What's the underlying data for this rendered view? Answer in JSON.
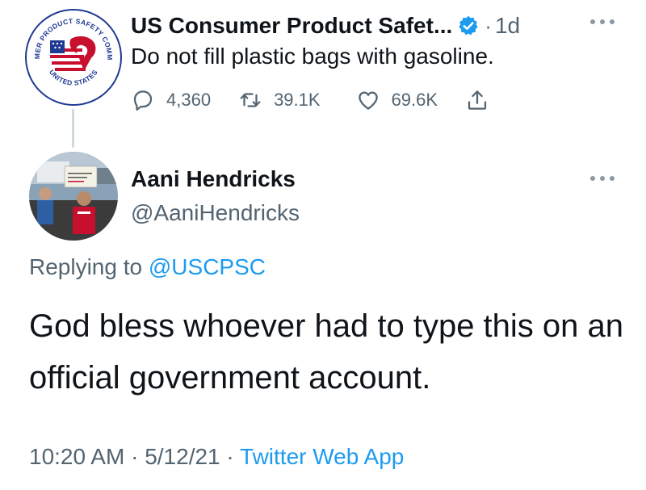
{
  "parent_tweet": {
    "display_name": "US Consumer Product Safet...",
    "time_ago": "1d",
    "separator": "·",
    "text": "Do not fill plastic bags with gasoline.",
    "seal": {
      "top_text": "CONSUMER PRODUCT SAFETY COMMISSION",
      "bottom_text": "UNITED STATES"
    },
    "actions": {
      "replies": "4,360",
      "retweets": "39.1K",
      "likes": "69.6K"
    },
    "icons": [
      "verified-badge-icon",
      "more-icon",
      "reply-icon",
      "retweet-icon",
      "like-icon",
      "share-icon"
    ]
  },
  "reply_tweet": {
    "display_name": "Aani Hendricks",
    "handle": "@AaniHendricks",
    "replying_prefix": "Replying to",
    "replying_to": "@USCPSC",
    "text": "God bless whoever had to type this on an official government account.",
    "time": "10:20 AM",
    "date": "5/12/21",
    "separator": "·",
    "source": "Twitter Web App",
    "icons": [
      "more-icon"
    ]
  },
  "colors": {
    "text_primary": "#0f1419",
    "text_secondary": "#536471",
    "accent": "#1d9bf0",
    "thread_line": "#cfd9de",
    "seal_red": "#c8102e",
    "seal_blue": "#1f3a93"
  }
}
